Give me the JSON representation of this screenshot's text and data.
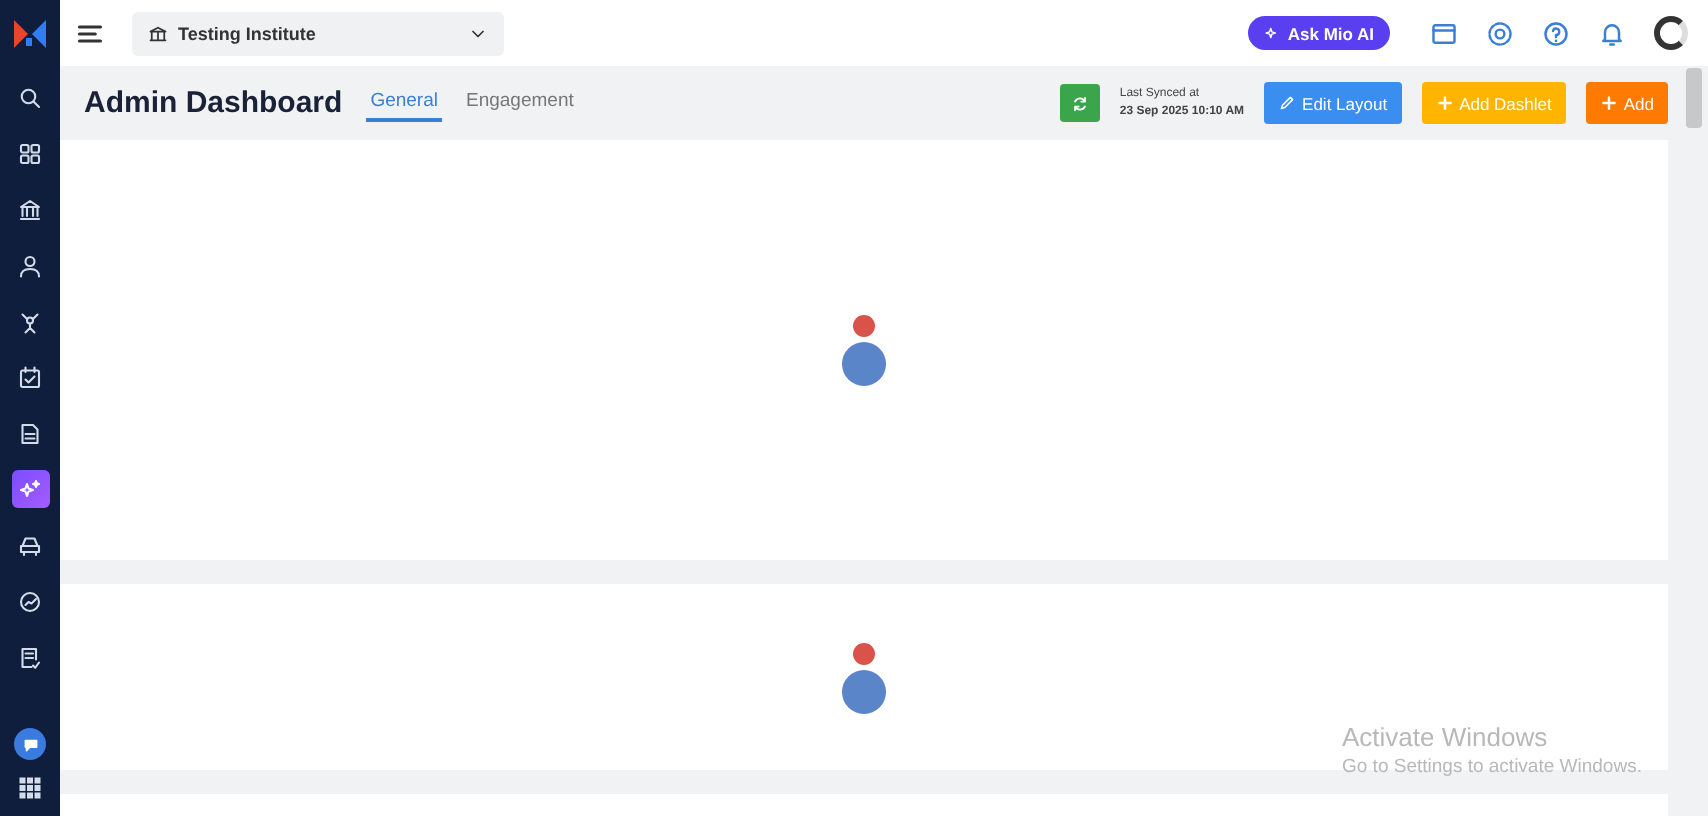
{
  "sidebar": {
    "items": [
      {
        "selected": false
      },
      {
        "selected": false
      },
      {
        "selected": false
      },
      {
        "selected": false
      },
      {
        "selected": false
      },
      {
        "selected": false
      },
      {
        "selected": false
      },
      {
        "selected": true
      },
      {
        "selected": false
      },
      {
        "selected": false
      },
      {
        "selected": false
      }
    ]
  },
  "topbar": {
    "institute": "Testing Institute",
    "ask_button": "Ask Mio AI"
  },
  "header": {
    "title": "Admin Dashboard",
    "tabs": [
      {
        "label": "General",
        "selected": true
      },
      {
        "label": "Engagement",
        "selected": false
      }
    ],
    "sync_label": "Last Synced at",
    "sync_time": "23 Sep 2025 10:10 AM",
    "buttons": [
      {
        "label": "Edit Layout",
        "kind": "edit"
      },
      {
        "label": "Add Dashlet",
        "kind": "dashlet"
      },
      {
        "label": "Add",
        "kind": "add"
      }
    ]
  },
  "cards": [
    {
      "kind": "loading"
    },
    {
      "kind": "loading"
    },
    {
      "kind": "blank"
    }
  ],
  "os_notice": {
    "title": "Activate Windows",
    "text": "Go to Settings to activate Windows."
  }
}
